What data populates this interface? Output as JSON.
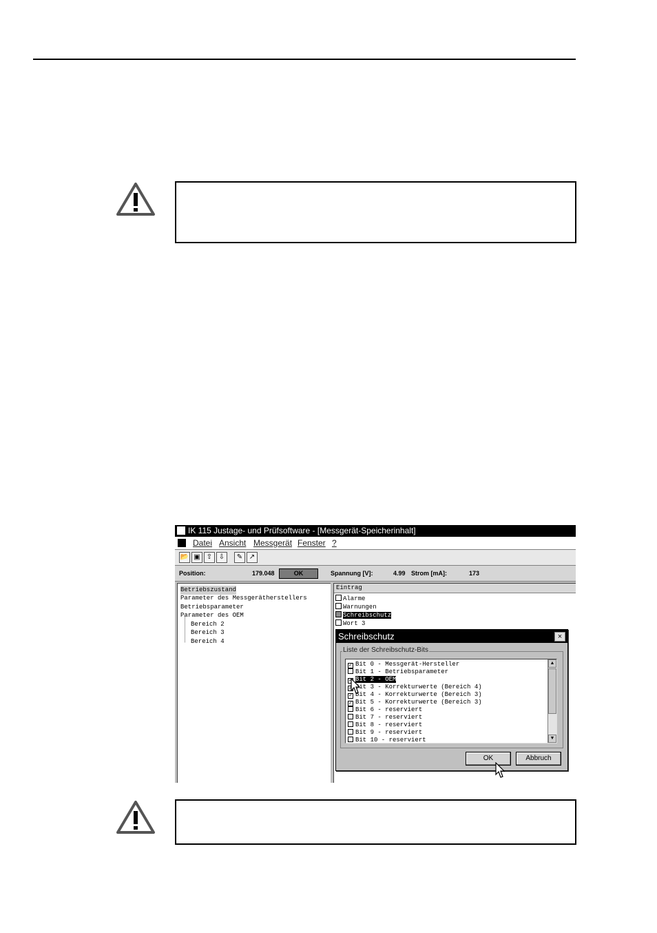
{
  "app": {
    "title": "IK 115 Justage- und Prüfsoftware - [Messgerät-Speicherinhalt]",
    "menu": [
      "Datei",
      "Ansicht",
      "Messgerät",
      "Fenster",
      "?"
    ],
    "status": {
      "position_label": "Position:",
      "position_value": "179.048",
      "ok_label": "OK",
      "spannung_label": "Spannung [V]:",
      "spannung_value": "4.99",
      "strom_label": "Strom [mA]:",
      "strom_value": "173"
    },
    "tree": {
      "items": [
        "Betriebszustand",
        "Parameter des Messgerätherstellers",
        "Betriebsparameter",
        "Parameter des OEM"
      ],
      "subitems": [
        "Bereich 2",
        "Bereich 3",
        "Bereich 4"
      ]
    },
    "entries": {
      "header": "Eintrag",
      "items": [
        "Alarme",
        "Warnungen",
        "Schreibschutz",
        "Wort 3"
      ]
    }
  },
  "dialog": {
    "title": "Schreibschutz",
    "close": "×",
    "group_label": "Liste der Schreibschutz-Bits",
    "bits": [
      {
        "label": "Bit  0 - Messgerät-Hersteller",
        "checked": true
      },
      {
        "label": "Bit  1 - Betriebsparameter",
        "checked": false
      },
      {
        "label": "Bit  2 - OEM",
        "checked": true
      },
      {
        "label": "Bit  3 - Korrekturwerte (Bereich 4)",
        "checked": true
      },
      {
        "label": "Bit  4 - Korrekturwerte (Bereich 3)",
        "checked": true
      },
      {
        "label": "Bit  5 - Korrekturwerte (Bereich 3)",
        "checked": true
      },
      {
        "label": "Bit  6 - reserviert",
        "checked": false
      },
      {
        "label": "Bit  7 - reserviert",
        "checked": false
      },
      {
        "label": "Bit  8 - reserviert",
        "checked": false
      },
      {
        "label": "Bit  9 - reserviert",
        "checked": false
      },
      {
        "label": "Bit 10 - reserviert",
        "checked": false
      }
    ],
    "ok_label": "OK",
    "cancel_label": "Abbruch"
  }
}
